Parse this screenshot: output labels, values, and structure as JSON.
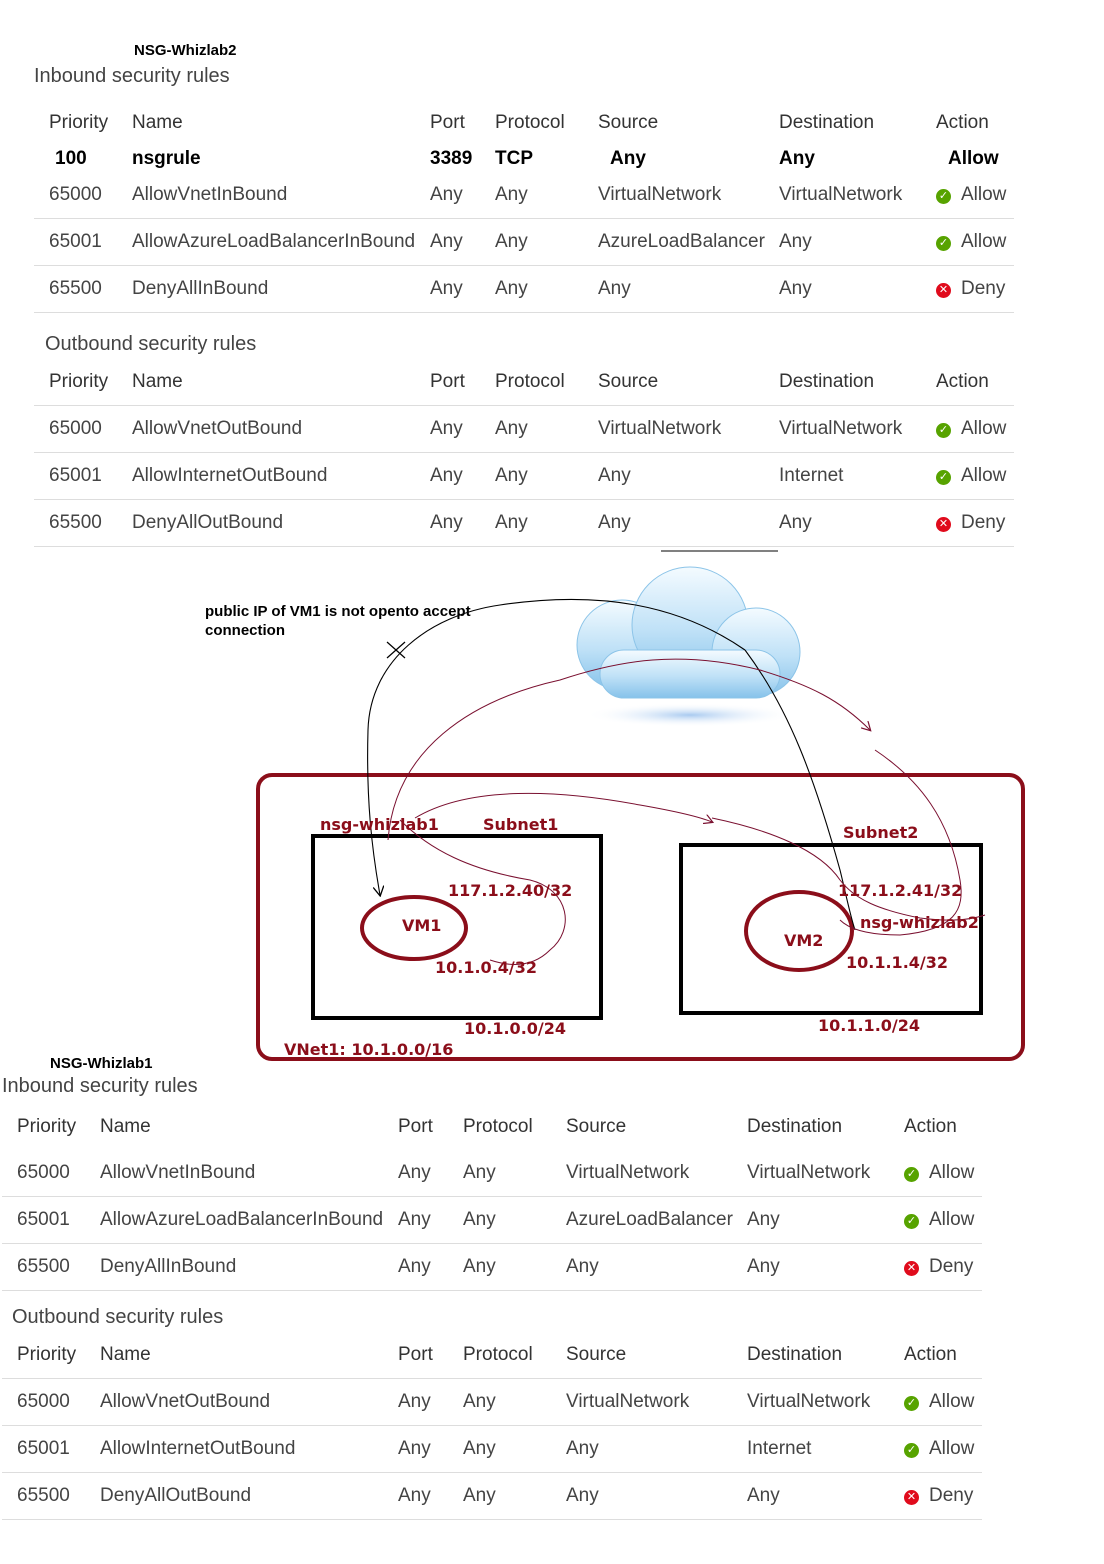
{
  "top_nsg": {
    "title": "NSG-Whizlab2",
    "inbound_title": "Inbound security rules",
    "outbound_title": "Outbound security rules",
    "headers": [
      "Priority",
      "Name",
      "Port",
      "Protocol",
      "Source",
      "Destination",
      "Action"
    ],
    "custom_rule": {
      "priority": "100",
      "name": "nsgrule",
      "port": "3389",
      "protocol": "TCP",
      "source": "Any",
      "destination": "Any",
      "action": "Allow"
    },
    "inbound_rows": [
      {
        "priority": "65000",
        "name": "AllowVnetInBound",
        "port": "Any",
        "protocol": "Any",
        "source": "VirtualNetwork",
        "destination": "VirtualNetwork",
        "action": "Allow",
        "status": "allow"
      },
      {
        "priority": "65001",
        "name": "AllowAzureLoadBalancerInBound",
        "port": "Any",
        "protocol": "Any",
        "source": "AzureLoadBalancer",
        "destination": "Any",
        "action": "Allow",
        "status": "allow"
      },
      {
        "priority": "65500",
        "name": "DenyAllInBound",
        "port": "Any",
        "protocol": "Any",
        "source": "Any",
        "destination": "Any",
        "action": "Deny",
        "status": "deny"
      }
    ],
    "outbound_rows": [
      {
        "priority": "65000",
        "name": "AllowVnetOutBound",
        "port": "Any",
        "protocol": "Any",
        "source": "VirtualNetwork",
        "destination": "VirtualNetwork",
        "action": "Allow",
        "status": "allow"
      },
      {
        "priority": "65001",
        "name": "AllowInternetOutBound",
        "port": "Any",
        "protocol": "Any",
        "source": "Any",
        "destination": "Internet",
        "action": "Allow",
        "status": "allow"
      },
      {
        "priority": "65500",
        "name": "DenyAllOutBound",
        "port": "Any",
        "protocol": "Any",
        "source": "Any",
        "destination": "Any",
        "action": "Deny",
        "status": "deny"
      }
    ]
  },
  "diagram": {
    "note": "public IP of VM1 is not opento accept connection",
    "nsg1_label": "nsg-whizlab1",
    "subnet1_label": "Subnet1",
    "subnet2_label": "Subnet2",
    "vm1_label": "VM1",
    "vm2_label": "VM2",
    "vm1_public_ip": "117.1.2.40/32",
    "vm2_public_ip": "117.1.2.41/32",
    "nsg2_label": "nsg-whizlab2",
    "vm1_private_ip": "10.1.0.4/32",
    "vm2_private_ip": "10.1.1.4/32",
    "subnet1_cidr": "10.1.0.0/24",
    "subnet2_cidr": "10.1.1.0/24",
    "vnet_label": "VNet1: 10.1.0.0/16",
    "colors": {
      "vnet": "#8b0e1a",
      "subnet_box": "#000000",
      "arrow": "#000000",
      "red_path": "#7a1030"
    }
  },
  "bottom_nsg": {
    "title": "NSG-Whizlab1",
    "inbound_title": "Inbound security rules",
    "outbound_title": "Outbound security rules",
    "headers": [
      "Priority",
      "Name",
      "Port",
      "Protocol",
      "Source",
      "Destination",
      "Action"
    ],
    "inbound_rows": [
      {
        "priority": "65000",
        "name": "AllowVnetInBound",
        "port": "Any",
        "protocol": "Any",
        "source": "VirtualNetwork",
        "destination": "VirtualNetwork",
        "action": "Allow",
        "status": "allow"
      },
      {
        "priority": "65001",
        "name": "AllowAzureLoadBalancerInBound",
        "port": "Any",
        "protocol": "Any",
        "source": "AzureLoadBalancer",
        "destination": "Any",
        "action": "Allow",
        "status": "allow"
      },
      {
        "priority": "65500",
        "name": "DenyAllInBound",
        "port": "Any",
        "protocol": "Any",
        "source": "Any",
        "destination": "Any",
        "action": "Deny",
        "status": "deny"
      }
    ],
    "outbound_rows": [
      {
        "priority": "65000",
        "name": "AllowVnetOutBound",
        "port": "Any",
        "protocol": "Any",
        "source": "VirtualNetwork",
        "destination": "VirtualNetwork",
        "action": "Allow",
        "status": "allow"
      },
      {
        "priority": "65001",
        "name": "AllowInternetOutBound",
        "port": "Any",
        "protocol": "Any",
        "source": "Any",
        "destination": "Internet",
        "action": "Allow",
        "status": "allow"
      },
      {
        "priority": "65500",
        "name": "DenyAllOutBound",
        "port": "Any",
        "protocol": "Any",
        "source": "Any",
        "destination": "Any",
        "action": "Deny",
        "status": "deny"
      }
    ]
  }
}
